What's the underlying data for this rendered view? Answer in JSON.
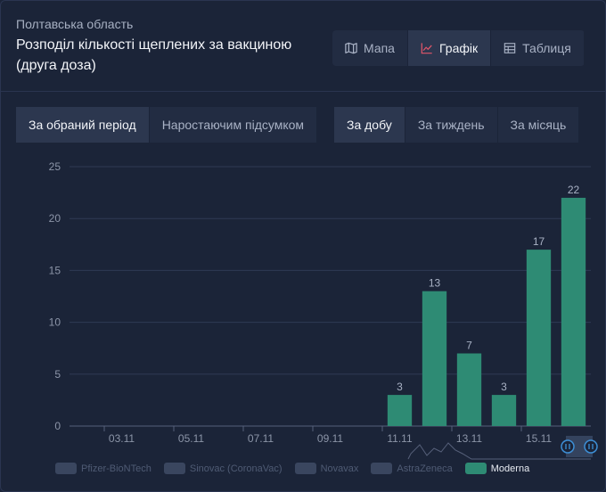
{
  "header": {
    "region": "Полтавська область",
    "title": "Розподіл кількості щеплених за вакциною (друга доза)"
  },
  "view_buttons": [
    {
      "label": "Мапа",
      "icon": "map-icon",
      "active": false
    },
    {
      "label": "Графік",
      "icon": "chart-line-icon",
      "active": true
    },
    {
      "label": "Таблиця",
      "icon": "table-icon",
      "active": false
    }
  ],
  "mode_tabs": [
    {
      "label": "За обраний період",
      "active": true
    },
    {
      "label": "Наростаючим підсумком",
      "active": false
    }
  ],
  "period_tabs": [
    {
      "label": "За добу",
      "active": true
    },
    {
      "label": "За тиждень",
      "active": false
    },
    {
      "label": "За місяць",
      "active": false
    }
  ],
  "colors": {
    "moderna": "#2e8b74",
    "inactive_legend": "#3a465f",
    "accent_icon": "#e0566a"
  },
  "chart_data": {
    "type": "bar",
    "series": [
      {
        "name": "Moderna",
        "values": [
          {
            "x": "11.11",
            "y": 3
          },
          {
            "x": "12.11",
            "y": 13
          },
          {
            "x": "13.11",
            "y": 7
          },
          {
            "x": "14.11",
            "y": 3
          },
          {
            "x": "15.11",
            "y": 17
          },
          {
            "x": "16.11",
            "y": 22
          }
        ]
      }
    ],
    "x_start": "02.11",
    "x_end": "16.11",
    "x_tick_labels": [
      "03.11",
      "05.11",
      "07.11",
      "09.11",
      "11.11",
      "13.11",
      "15.11"
    ],
    "ylim": [
      0,
      25
    ],
    "y_ticks": [
      0,
      5,
      10,
      15,
      20,
      25
    ],
    "grid": true,
    "legend": [
      {
        "label": "Pfizer-BioNTech",
        "active": false
      },
      {
        "label": "Sinovac (CoronaVac)",
        "active": false
      },
      {
        "label": "Novavax",
        "active": false
      },
      {
        "label": "AstraZeneca",
        "active": false
      },
      {
        "label": "Moderna",
        "active": true
      }
    ],
    "legend_placement": "bottom"
  }
}
